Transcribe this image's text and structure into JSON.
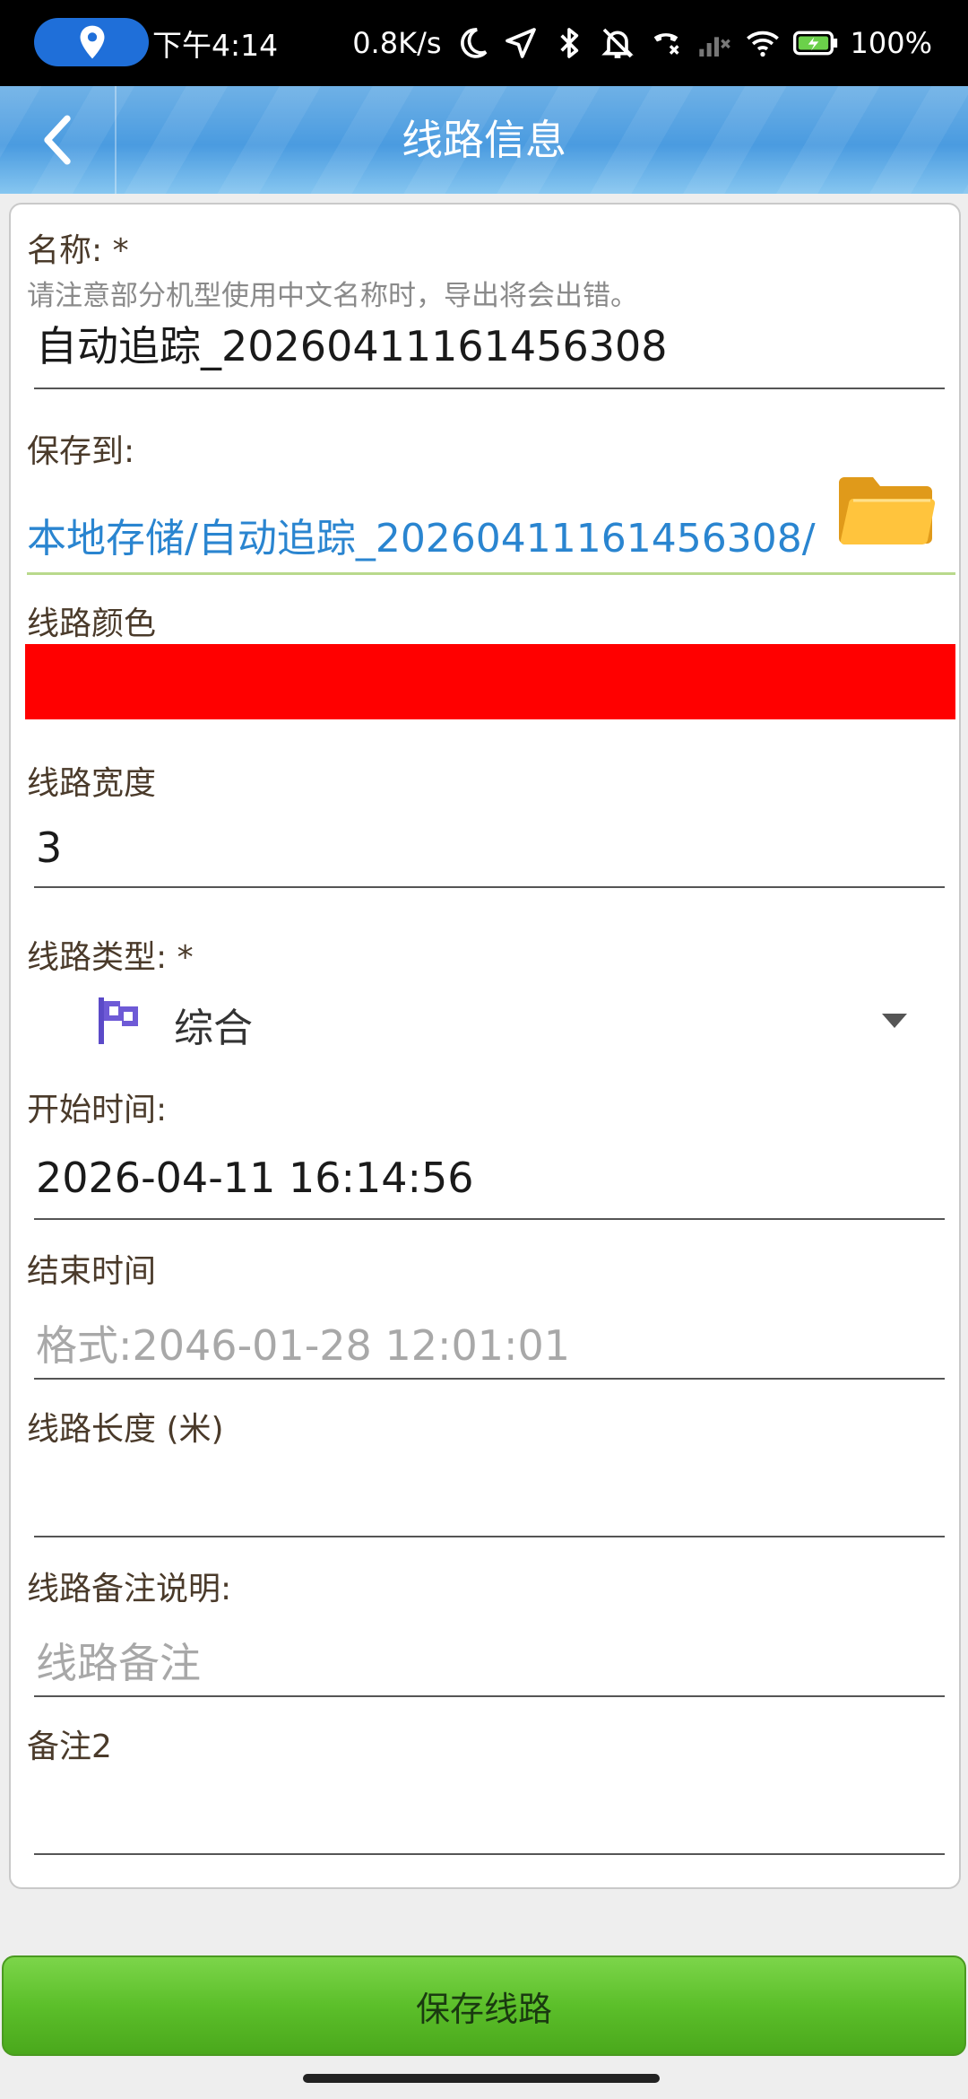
{
  "status_bar": {
    "time": "下午4:14",
    "net_speed": "0.8K/s",
    "battery": "100%",
    "icons": [
      "location-icon",
      "moon-icon",
      "navigation-icon",
      "bluetooth-icon",
      "mute-icon",
      "call-icon",
      "signal-icon",
      "wifi-icon",
      "battery-icon"
    ]
  },
  "title_bar": {
    "title": "线路信息",
    "back_icon": "chevron-left-icon"
  },
  "form": {
    "name_label": "名称: *",
    "name_hint": "请注意部分机型使用中文名称时，导出将会出错。",
    "name_value": "自动追踪_20260411161456308",
    "save_to_label": "保存到:",
    "save_to_path": "本地存储/自动追踪_20260411161456308/",
    "folder_icon": "folder-icon",
    "color_label": "线路颜色",
    "color_value": "#ff0000",
    "width_label": "线路宽度",
    "width_value": "3",
    "type_label": "线路类型: *",
    "type_value": "综合",
    "type_icon": "flag-icon",
    "start_time_label": "开始时间:",
    "start_time_value": "2026-04-11 16:14:56",
    "end_time_label": "结束时间",
    "end_time_placeholder": "格式:2046-01-28 12:01:01",
    "length_label": "线路长度 (米)",
    "length_value": "",
    "note_label": "线路备注说明:",
    "note_placeholder": "线路备注",
    "note2_label": "备注2",
    "note2_value": ""
  },
  "footer": {
    "save_button": "保存线路"
  },
  "colors": {
    "accent_blue": "#2a85d0",
    "save_green": "#5cbf2a",
    "title_bar": "#4a9be0"
  }
}
